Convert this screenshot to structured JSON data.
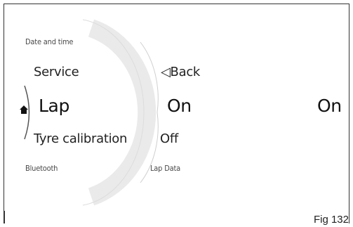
{
  "left_menu": {
    "items": [
      {
        "label": "Date and time"
      },
      {
        "label": "Service"
      },
      {
        "label": "Lap"
      },
      {
        "label": "Tyre calibration"
      },
      {
        "label": "Bluetooth"
      }
    ],
    "selected_icon": "home-icon"
  },
  "sub_menu": {
    "back_label": "◁Back",
    "items": [
      {
        "label": "On"
      },
      {
        "label": "Off"
      }
    ],
    "footer_label": "Lap Data"
  },
  "value_panel": {
    "current_value": "On"
  },
  "caption": "Fig 132"
}
